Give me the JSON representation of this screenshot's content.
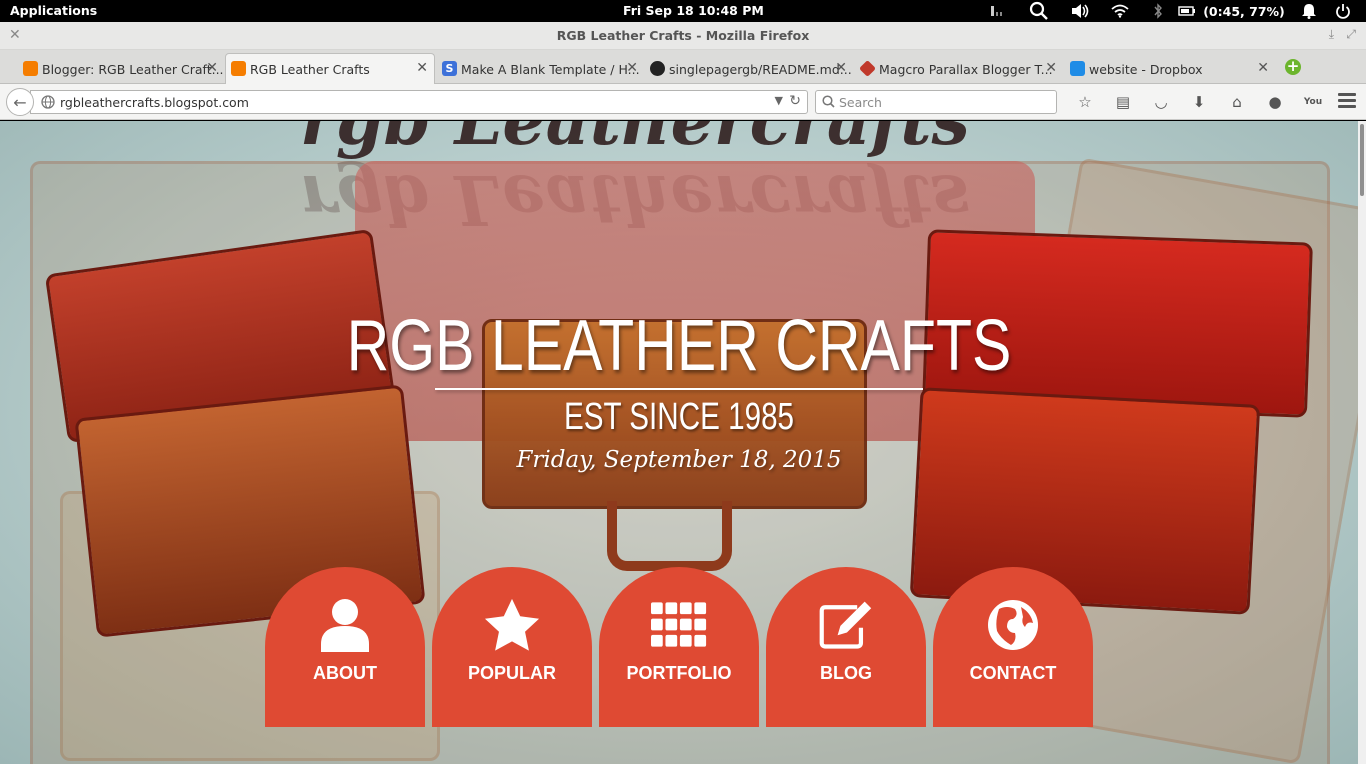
{
  "system_bar": {
    "applications": "Applications",
    "clock": "Fri Sep 18    10:48 PM",
    "battery": "(0:45, 77%)"
  },
  "window": {
    "title": "RGB Leather Crafts - Mozilla Firefox"
  },
  "tabs": [
    {
      "label": "Blogger: RGB Leather Craft...",
      "favicon": "blogger-icon",
      "color": "#f57d00"
    },
    {
      "label": "RGB Leather Crafts",
      "favicon": "blogger-icon",
      "color": "#f57d00",
      "active": true
    },
    {
      "label": "Make A Blank Template / H...",
      "favicon": "s-icon",
      "color": "#3d71d9"
    },
    {
      "label": "singlepagergb/README.md...",
      "favicon": "github-icon",
      "color": "#222222"
    },
    {
      "label": "Magcro Parallax Blogger T...",
      "favicon": "magcro-icon",
      "color": "#c0392b"
    },
    {
      "label": "website - Dropbox",
      "favicon": "dropbox-icon",
      "color": "#1f8ce6"
    }
  ],
  "navbar": {
    "url": "rgbleathercrafts.blogspot.com",
    "search_placeholder": "Search"
  },
  "hero": {
    "title": "RGB LEATHER CRAFTS",
    "subtitle": "EST SINCE 1985",
    "date": "Friday, September 18, 2015",
    "background_script": "rgb Leathercrafts"
  },
  "menu": [
    {
      "label": "ABOUT",
      "icon": "user-icon"
    },
    {
      "label": "POPULAR",
      "icon": "star-icon"
    },
    {
      "label": "PORTFOLIO",
      "icon": "grid-icon"
    },
    {
      "label": "BLOG",
      "icon": "edit-icon"
    },
    {
      "label": "CONTACT",
      "icon": "globe-icon"
    }
  ],
  "colors": {
    "accent": "#df4a33"
  }
}
